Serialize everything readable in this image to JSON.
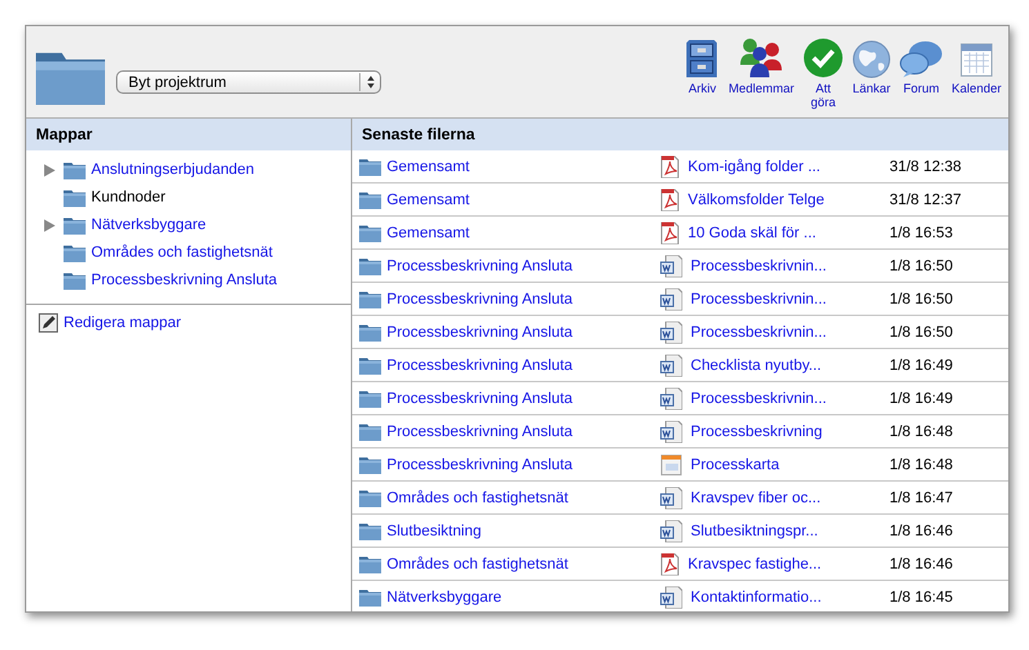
{
  "toolbar": {
    "project_select": {
      "value": "Byt projektrum"
    },
    "buttons": [
      {
        "label": "Arkiv"
      },
      {
        "label": "Medlemmar"
      },
      {
        "label": "Att\ngöra"
      },
      {
        "label": "Länkar"
      },
      {
        "label": "Forum"
      },
      {
        "label": "Kalender"
      }
    ]
  },
  "folders": {
    "title": "Mappar",
    "items": [
      {
        "label": "Anslutningserbjudanden",
        "has_children": true,
        "selected": false
      },
      {
        "label": "Kundnoder",
        "has_children": false,
        "selected": true
      },
      {
        "label": "Nätverksbyggare",
        "has_children": true,
        "selected": false
      },
      {
        "label": "Områdes och fastighetsnät",
        "has_children": false,
        "selected": false
      },
      {
        "label": "Processbeskrivning Ansluta",
        "has_children": false,
        "selected": false
      }
    ],
    "edit_link": "Redigera mappar"
  },
  "recent_files": {
    "title": "Senaste filerna",
    "rows": [
      {
        "folder": "Gemensamt",
        "kind": "pdf",
        "file": "Kom-igång folder ...",
        "time": "31/8 12:38"
      },
      {
        "folder": "Gemensamt",
        "kind": "pdf",
        "file": "Välkomsfolder Telge",
        "time": "31/8 12:37"
      },
      {
        "folder": "Gemensamt",
        "kind": "pdf",
        "file": "10 Goda skäl för ...",
        "time": "1/8 16:53"
      },
      {
        "folder": "Processbeskrivning Ansluta",
        "kind": "word",
        "file": "Processbeskrivnin...",
        "time": "1/8 16:50"
      },
      {
        "folder": "Processbeskrivning Ansluta",
        "kind": "word",
        "file": "Processbeskrivnin...",
        "time": "1/8 16:50"
      },
      {
        "folder": "Processbeskrivning Ansluta",
        "kind": "word",
        "file": "Processbeskrivnin...",
        "time": "1/8 16:50"
      },
      {
        "folder": "Processbeskrivning Ansluta",
        "kind": "word",
        "file": "Checklista nyutby...",
        "time": "1/8 16:49"
      },
      {
        "folder": "Processbeskrivning Ansluta",
        "kind": "word",
        "file": "Processbeskrivnin...",
        "time": "1/8 16:49"
      },
      {
        "folder": "Processbeskrivning Ansluta",
        "kind": "word",
        "file": "Processbeskrivning",
        "time": "1/8 16:48"
      },
      {
        "folder": "Processbeskrivning Ansluta",
        "kind": "slides",
        "file": "Processkarta",
        "time": "1/8 16:48"
      },
      {
        "folder": "Områdes och fastighetsnät",
        "kind": "word",
        "file": "Kravspev fiber oc...",
        "time": "1/8 16:47"
      },
      {
        "folder": "Slutbesiktning",
        "kind": "word",
        "file": "Slutbesiktningspr...",
        "time": "1/8 16:46"
      },
      {
        "folder": "Områdes och fastighetsnät",
        "kind": "pdf",
        "file": "Kravspec fastighe...",
        "time": "1/8 16:46"
      },
      {
        "folder": "Nätverksbyggare",
        "kind": "word",
        "file": "Kontaktinformatio...",
        "time": "1/8 16:45"
      }
    ]
  }
}
